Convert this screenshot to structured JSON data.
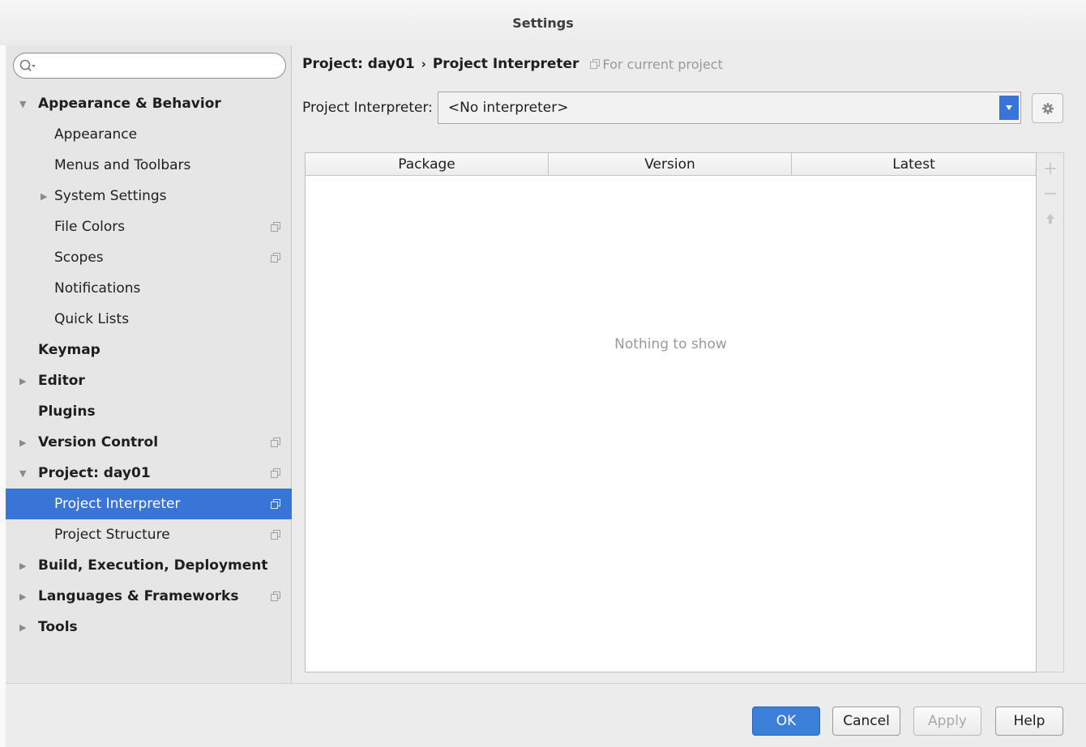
{
  "window": {
    "title": "Settings"
  },
  "search": {
    "placeholder": ""
  },
  "tree": [
    {
      "label": "Appearance & Behavior",
      "level": 0,
      "arrow": "down"
    },
    {
      "label": "Appearance",
      "level": 1
    },
    {
      "label": "Menus and Toolbars",
      "level": 1
    },
    {
      "label": "System Settings",
      "level": 1,
      "arrow": "right"
    },
    {
      "label": "File Colors",
      "level": 1,
      "copy": true
    },
    {
      "label": "Scopes",
      "level": 1,
      "copy": true
    },
    {
      "label": "Notifications",
      "level": 1
    },
    {
      "label": "Quick Lists",
      "level": 1
    },
    {
      "label": "Keymap",
      "level": 0
    },
    {
      "label": "Editor",
      "level": 0,
      "arrow": "right"
    },
    {
      "label": "Plugins",
      "level": 0
    },
    {
      "label": "Version Control",
      "level": 0,
      "arrow": "right",
      "copy": true
    },
    {
      "label": "Project: day01",
      "level": 0,
      "arrow": "down",
      "copy": true
    },
    {
      "label": "Project Interpreter",
      "level": 1,
      "copy": true,
      "selected": true
    },
    {
      "label": "Project Structure",
      "level": 1,
      "copy": true
    },
    {
      "label": "Build, Execution, Deployment",
      "level": 0,
      "arrow": "right"
    },
    {
      "label": "Languages & Frameworks",
      "level": 0,
      "arrow": "right",
      "copy": true
    },
    {
      "label": "Tools",
      "level": 0,
      "arrow": "right"
    }
  ],
  "breadcrumb": {
    "project": "Project: day01",
    "separator": "›",
    "page": "Project Interpreter",
    "scope": "For current project"
  },
  "interpreter": {
    "label": "Project Interpreter:",
    "value": "<No interpreter>"
  },
  "packages_table": {
    "columns": [
      "Package",
      "Version",
      "Latest"
    ],
    "empty_text": "Nothing to show"
  },
  "footer": {
    "ok": "OK",
    "cancel": "Cancel",
    "apply": "Apply",
    "help": "Help"
  },
  "colors": {
    "selection": "#3875d7",
    "ok_button": "#3c7fd9"
  }
}
